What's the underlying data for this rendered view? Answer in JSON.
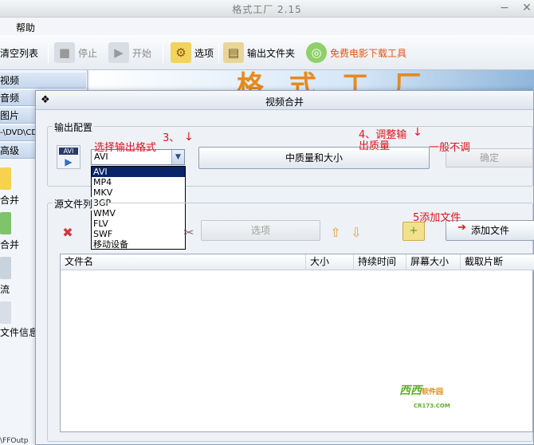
{
  "app": {
    "title": "格式工厂 2.15",
    "window_controls": {
      "minimize": "−",
      "close": "✕"
    },
    "menu": [
      "帮助"
    ]
  },
  "toolbar": {
    "clear_list": "清空列表",
    "stop": "停止",
    "start": "开始",
    "options": "选项",
    "output_folder": "输出文件夹",
    "free_download": "免费电影下载工具",
    "free_download_color": "#e4540c"
  },
  "sidebar": {
    "categories": [
      "视频",
      "音频",
      "图片",
      "-\\DVD\\CD",
      "高级"
    ],
    "items": [
      "合并",
      "合并",
      "流",
      "文件信息"
    ]
  },
  "statusbar": "\\FFOutp",
  "dialog": {
    "title": "视频合并",
    "output_config": {
      "legend": "输出配置",
      "format_selected": "AVI",
      "format_options": [
        "AVI",
        "MP4",
        "MKV",
        "3GP",
        "WMV",
        "FLV",
        "SWF",
        "移动设备"
      ],
      "quality_button": "中质量和大小",
      "ok_button": "确定"
    },
    "source_files": {
      "legend": "源文件列",
      "options_button": "选项",
      "add_file_button": "添加文件",
      "columns": [
        "文件名",
        "大小",
        "持续时间",
        "屏幕大小",
        "截取片断"
      ]
    },
    "watermark": {
      "brand": "西西",
      "sub": "软件园",
      "url": "CR173.COM"
    }
  },
  "annotations": {
    "step3": "3、",
    "step3_label": "选择输出格式",
    "step4_line1": "4、调整输",
    "step4_line2": "出质量",
    "step4_note": "一般不调",
    "step5": "5添加文件",
    "color": "#e1141b"
  }
}
